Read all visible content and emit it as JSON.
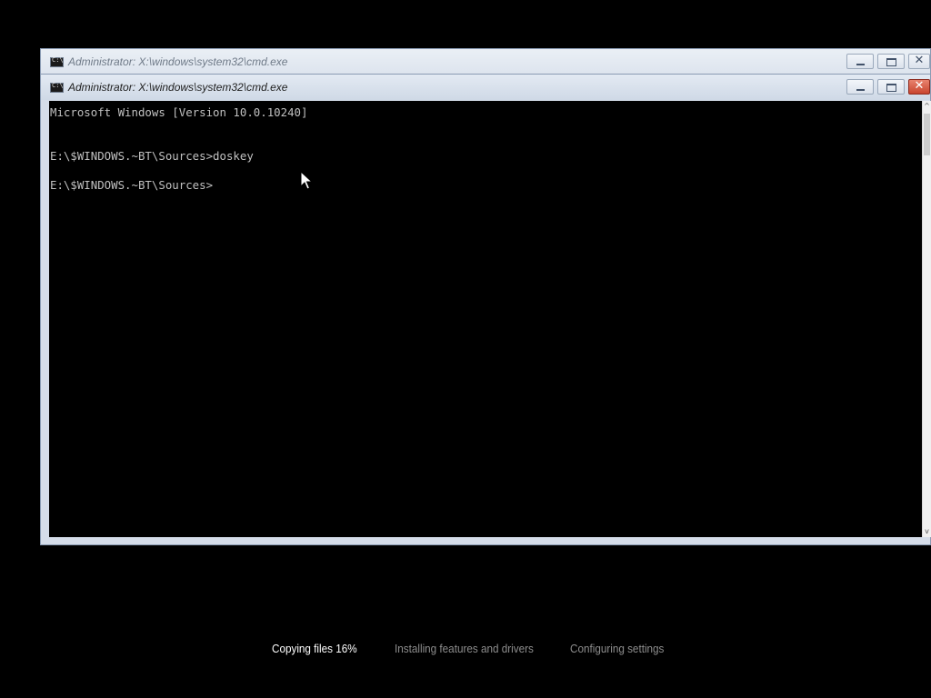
{
  "windows": {
    "background": {
      "title": "Administrator: X:\\windows\\system32\\cmd.exe",
      "controls": {
        "minimize": "",
        "maximize": "",
        "close": "✕"
      }
    },
    "foreground": {
      "title": "Administrator: X:\\windows\\system32\\cmd.exe",
      "controls": {
        "minimize": "",
        "maximize": "",
        "close": "✕"
      },
      "console": {
        "lines": [
          "Microsoft Windows [Version 10.0.10240]",
          "E:\\$WINDOWS.~BT\\Sources>doskey",
          "E:\\$WINDOWS.~BT\\Sources>"
        ]
      },
      "scrollbar": {
        "up_glyph": "^",
        "down_glyph": "v"
      }
    }
  },
  "setup_progress": {
    "steps": [
      {
        "label": "Copying files 16%",
        "state": "active"
      },
      {
        "label": "Installing features and drivers",
        "state": "pending"
      },
      {
        "label": "Configuring settings",
        "state": "pending"
      }
    ]
  },
  "icons": {
    "app_icon": "cmd-icon",
    "cursor": "mouse-pointer-icon"
  },
  "colors": {
    "console_bg": "#000000",
    "console_text": "#c0c0c0",
    "titlebar": "#d5dde9",
    "close_button": "#c9452f",
    "step_active": "#ffffff",
    "step_pending": "#8e8e8e"
  }
}
